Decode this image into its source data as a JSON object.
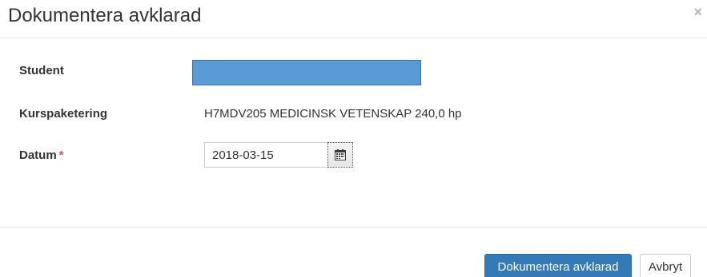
{
  "dialog": {
    "title": "Dokumentera avklarad",
    "close_label": "×"
  },
  "form": {
    "student_label": "Student",
    "kurspaketering_label": "Kurspaketering",
    "kurspaketering_value": "H7MDV205 MEDICINSK VETENSKAP 240,0 hp",
    "datum_label": "Datum",
    "required_marker": "*",
    "datum_value": "2018-03-15"
  },
  "footer": {
    "submit_label": "Dokumentera avklarad",
    "cancel_label": "Avbryt"
  },
  "icons": {
    "calendar": "calendar-icon",
    "close": "close-icon"
  },
  "colors": {
    "primary": "#337ab7",
    "required": "#d9534f",
    "redaction": "#5b9bd5"
  }
}
